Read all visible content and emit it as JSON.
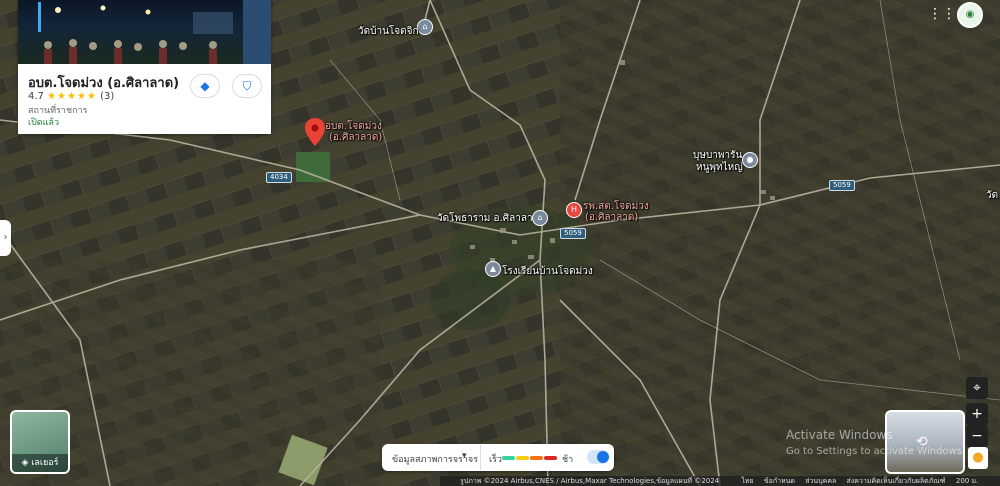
{
  "place_card": {
    "title": "อบต.โจดม่วง (อ.ศิลาลาด)",
    "rating": "4.7",
    "stars": "★★★★★",
    "review_count": "(3)",
    "category": "สถานที่ราชการ",
    "status": "เปิดแล้ว",
    "directions_icon": "directions-icon",
    "save_icon": "bookmark-icon"
  },
  "map_labels": {
    "temple_north": "วัดบ้านโจดจิก",
    "main_pin_line1": "อบต.โจดม่วง",
    "main_pin_line2": "(อ.ศิลาลาด)",
    "hospital_line1": "รพ.สต.โจดม่วง",
    "hospital_line2": "(อ.ศิลาลาด)",
    "temple_center": "วัดโพธาราม อ.ศิลาลาด",
    "school": "โรงเรียนบ้านโจดม่วง",
    "shrine_line1": "บุษบาพารัน",
    "shrine_line2": "หนูพุทไหญ่",
    "edge_label": "วัด",
    "road_4034": "4034",
    "road_5059_center": "5059",
    "road_5059_east": "5059"
  },
  "layers": {
    "label": "เลเยอร์"
  },
  "traffic": {
    "label": "ข้อมูลสภาพการจราจร",
    "fast": "เร็ว",
    "slow": "ช้า",
    "colors": [
      "#34d399",
      "#facc15",
      "#f97316",
      "#dc2626",
      "#9b1c1c"
    ]
  },
  "controls": {
    "zoom_in": "+",
    "zoom_out": "−"
  },
  "watermark": {
    "line1": "Activate Windows",
    "line2": "Go to Settings to activate Windows."
  },
  "footer": {
    "attribution": "รูปภาพ ©2024 Airbus,CNES / Airbus,Maxar Technologies,ข้อมูลแผนที่ ©2024",
    "country": "ไทย",
    "terms": "ข้อกำหนด",
    "privacy": "ส่วนบุคคล",
    "feedback": "ส่งความคิดเห็นเกี่ยวกับผลิตภัณฑ์",
    "scale": "200 ม."
  }
}
